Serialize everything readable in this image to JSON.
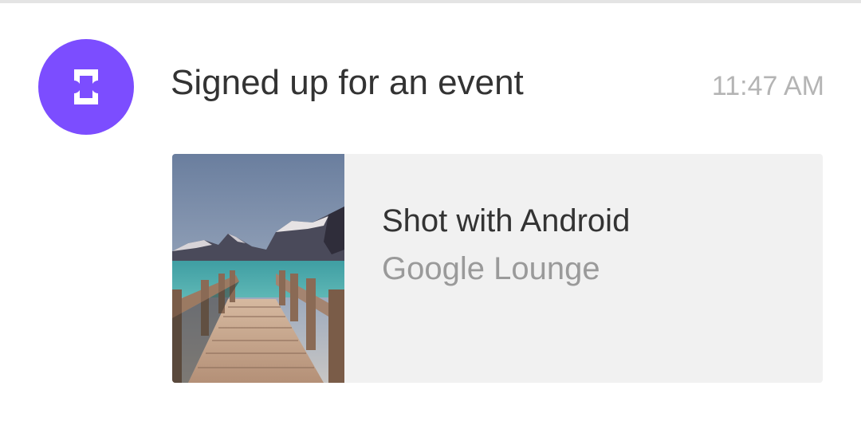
{
  "item": {
    "icon": "ticket-icon",
    "accent_color": "#7c4dff",
    "title": "Signed up for an event",
    "time": "11:47 AM"
  },
  "event_card": {
    "image": "lake-dock-photo",
    "title": "Shot with Android",
    "subtitle": "Google Lounge"
  }
}
